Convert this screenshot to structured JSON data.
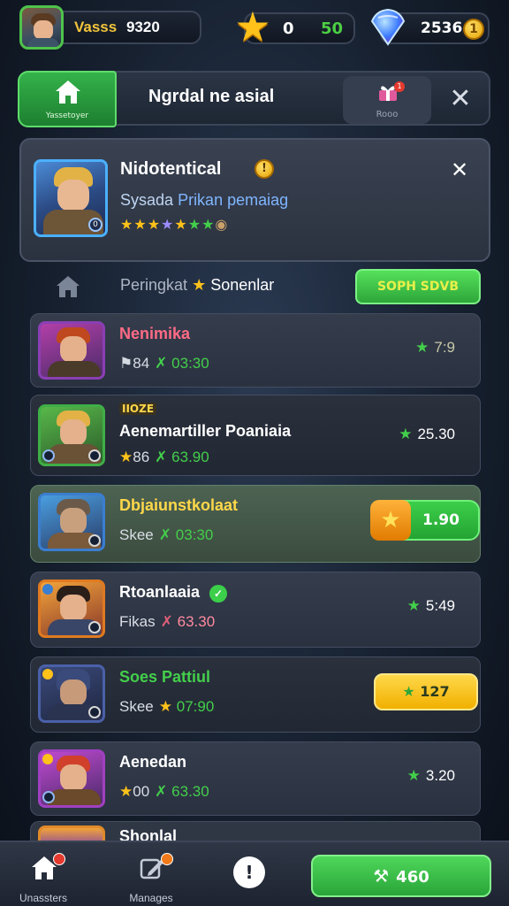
{
  "topbar": {
    "player_label": "Vasss",
    "player_value": "9320",
    "stars_value": "0",
    "stars_value2": "50",
    "gems_value": "2536",
    "coin_glyph": "1"
  },
  "header": {
    "home_label": "Yassetoyer",
    "title": "Ngrdal ne asial",
    "gift_label": "Rooo",
    "close_glyph": "✕"
  },
  "profile": {
    "name": "Nidotentical",
    "subtitle_a": "Sysada",
    "subtitle_b": "Prikan pemaiag",
    "info_glyph": "!",
    "level": "0",
    "close_glyph": "✕"
  },
  "ranking": {
    "title": "Peringkat",
    "subtitle": "Sonenlar",
    "button_label": "SOPH SDVB"
  },
  "rows": [
    {
      "name": "Nenimika",
      "stat_icon": "⚑",
      "stat_a": "84",
      "stat_b": "03:30",
      "score": "7:9",
      "name_color": "#ff6b86",
      "avatar_border": "#8a3fb4"
    },
    {
      "tag": "IIOZE",
      "name": "Aenemartiller Poaniaia",
      "stat_icon": "★",
      "stat_a": "86",
      "stat_b": "63.90",
      "score": "25.30",
      "name_color": "#ffffff",
      "avatar_border": "#3fae46"
    },
    {
      "name": "Dbjaiunstkolaat",
      "stat_label": "Skee",
      "stat_b": "03:30",
      "score": "1.90",
      "name_color": "#ffd84a",
      "avatar_border": "#3a7ed0"
    },
    {
      "name": "Rtoanlaaia",
      "stat_label": "Fikas",
      "stat_b": "63.30",
      "score": "5:49",
      "name_color": "#ffffff",
      "avatar_border": "#e07a20"
    },
    {
      "name": "Soes Pattiul",
      "stat_label": "Skee",
      "stat_b": "07:90",
      "score": "127",
      "name_color": "#43cf4b",
      "avatar_border": "#4a60a8"
    },
    {
      "name": "Aenedan",
      "stat_icon": "★",
      "stat_a": "00",
      "stat_b": "63.30",
      "score": "3.20",
      "name_color": "#ffffff",
      "avatar_border": "#a040c0"
    }
  ],
  "partial_row": {
    "name": "Shonlal"
  },
  "bottom": {
    "nav1_label": "Unassters",
    "nav2_label": "Manages",
    "info_glyph": "!",
    "action_label": "460"
  },
  "colors": {
    "accent_green": "#3ccf4a",
    "star_gold": "#ffc21a",
    "panel": "#2b323f"
  }
}
